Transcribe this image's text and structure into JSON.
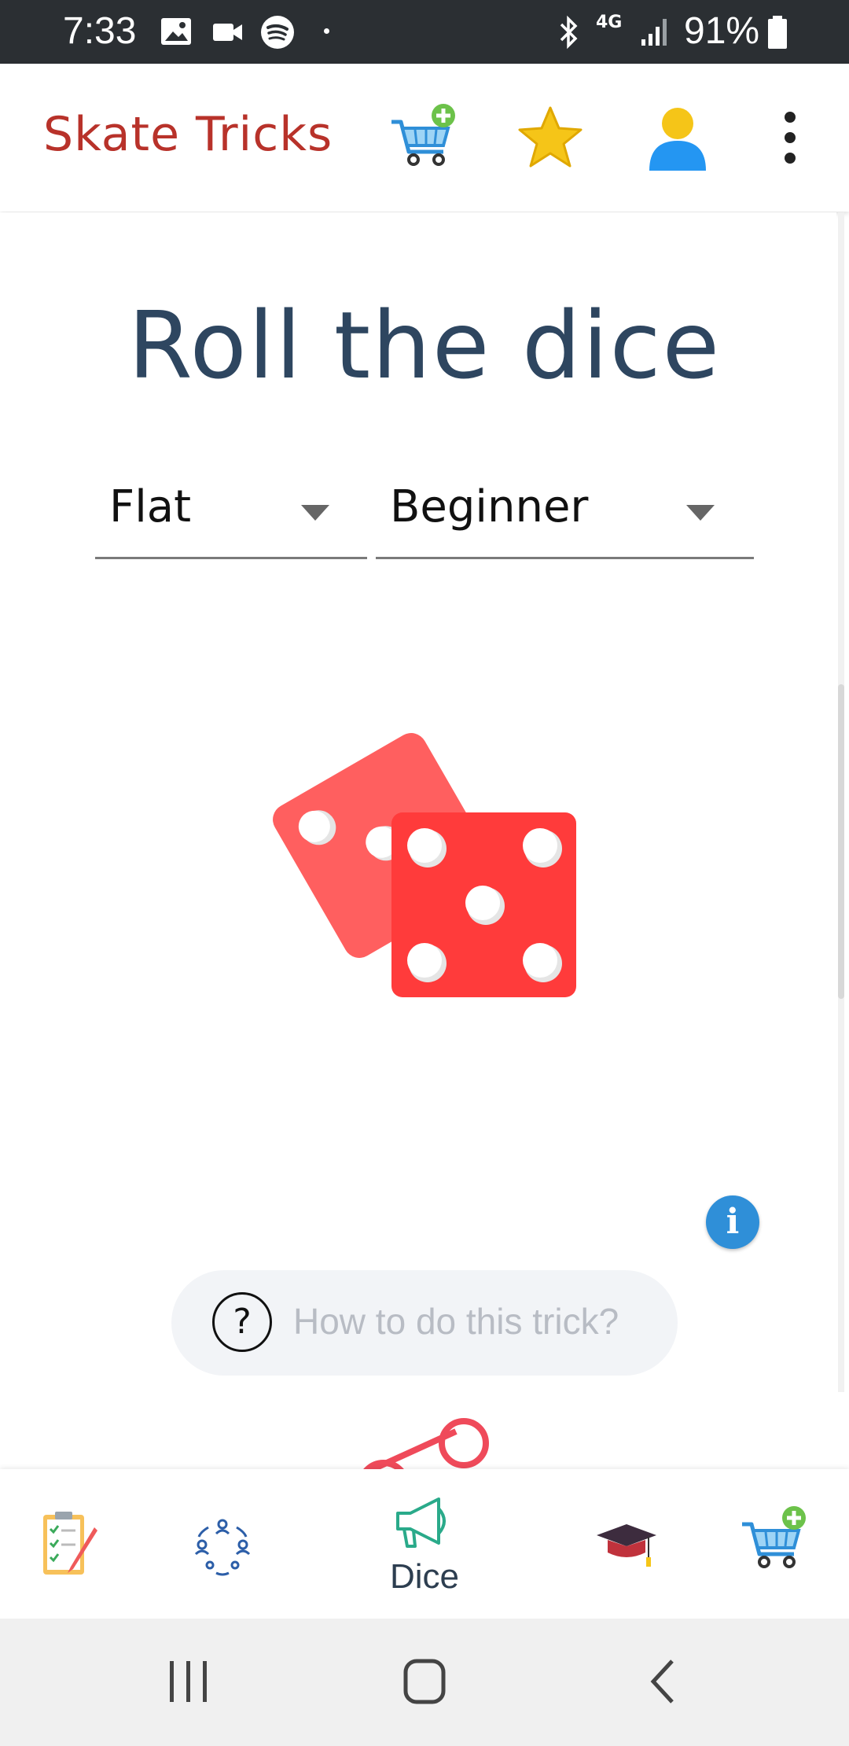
{
  "status_bar": {
    "time": "7:33",
    "battery": "91%",
    "network": "4G"
  },
  "app_bar": {
    "title": "Skate Tricks"
  },
  "main": {
    "title": "Roll the dice",
    "selects": [
      {
        "value": "Flat"
      },
      {
        "value": "Beginner"
      }
    ],
    "howto_label": "How to do this trick?",
    "info_glyph": "i",
    "help_glyph": "?"
  },
  "bottom_nav": {
    "items": [
      {
        "icon": "checklist-icon",
        "label": ""
      },
      {
        "icon": "community-icon",
        "label": ""
      },
      {
        "icon": "megaphone-icon",
        "label": "Dice"
      },
      {
        "icon": "graduation-cap-icon",
        "label": ""
      },
      {
        "icon": "cart-plus-icon",
        "label": ""
      }
    ]
  },
  "colors": {
    "title_red": "#b8322a",
    "heading_blue": "#2e4660",
    "die_light": "#ff5f5f",
    "die_dark": "#ff3b3b",
    "info_blue": "#2f8fd8"
  }
}
